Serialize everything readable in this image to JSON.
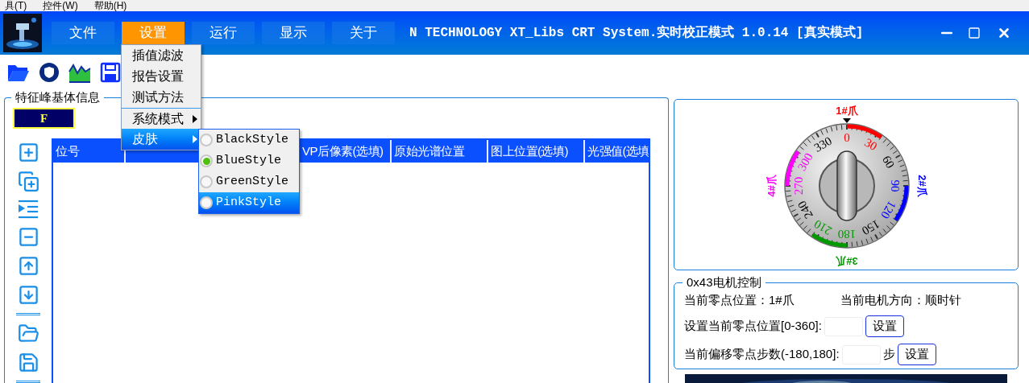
{
  "menubar": [
    "具(T)",
    "控件(W)",
    "帮助(H)"
  ],
  "nav": [
    {
      "label": "文件",
      "selected": false
    },
    {
      "label": "设置",
      "selected": true
    },
    {
      "label": "运行",
      "selected": false
    },
    {
      "label": "显示",
      "selected": false
    },
    {
      "label": "关于",
      "selected": false
    }
  ],
  "title": "N TECHNOLOGY XT_Libs CRT System.实时校正模式 1.0.14 [真实模式]",
  "dropdown": [
    {
      "label": "插值滤波",
      "submenu": false,
      "highlighted": false
    },
    {
      "label": "报告设置",
      "submenu": false,
      "highlighted": false
    },
    {
      "label": "测试方法",
      "submenu": false,
      "highlighted": false
    },
    {
      "label": "系统模式",
      "submenu": true,
      "highlighted": false
    },
    {
      "label": "皮肤",
      "submenu": true,
      "highlighted": true
    }
  ],
  "skin_menu": [
    {
      "label": "BlackStyle",
      "selected": false,
      "highlighted": false
    },
    {
      "label": "BlueStyle",
      "selected": true,
      "highlighted": false
    },
    {
      "label": "GreenStyle",
      "selected": false,
      "highlighted": false
    },
    {
      "label": "PinkStyle",
      "selected": false,
      "highlighted": true
    }
  ],
  "group": {
    "title": "特征峰基体信息",
    "badge": "F"
  },
  "table": {
    "columns": [
      "位号",
      "VP后像素(选填)",
      "原始光谱位置",
      "图上位置(选填)",
      "光强值(选填"
    ]
  },
  "dial": {
    "scale": [
      {
        "label": "0",
        "color": "#ff0000"
      },
      {
        "label": "30",
        "color": "#ff0000"
      },
      {
        "label": "60",
        "color": "#000000"
      },
      {
        "label": "90",
        "color": "#0000ff"
      },
      {
        "label": "120",
        "color": "#0000ff"
      },
      {
        "label": "150",
        "color": "#000000"
      },
      {
        "label": "180",
        "color": "#009900"
      },
      {
        "label": "210",
        "color": "#009900"
      },
      {
        "label": "240",
        "color": "#000000"
      },
      {
        "label": "270",
        "color": "#ff00ff"
      },
      {
        "label": "300",
        "color": "#ff00ff"
      },
      {
        "label": "330",
        "color": "#000000"
      }
    ],
    "claws": [
      {
        "label": "1#爪",
        "color": "#ff0000"
      },
      {
        "label": "2#爪",
        "color": "#0000ff"
      },
      {
        "label": "3#爪",
        "color": "#009900"
      },
      {
        "label": "4#爪",
        "color": "#ff00ff"
      }
    ]
  },
  "motor": {
    "title": "0x43电机控制",
    "zero_position": "当前零点位置：1#爪",
    "direction": "当前电机方向：顺时针",
    "zero_label": "设置当前零点位置[0-360]:",
    "zero_button": "设置",
    "offset_label": "当前偏移零点步数(-180,180]:",
    "offset_unit": "步",
    "offset_button": "设置"
  }
}
